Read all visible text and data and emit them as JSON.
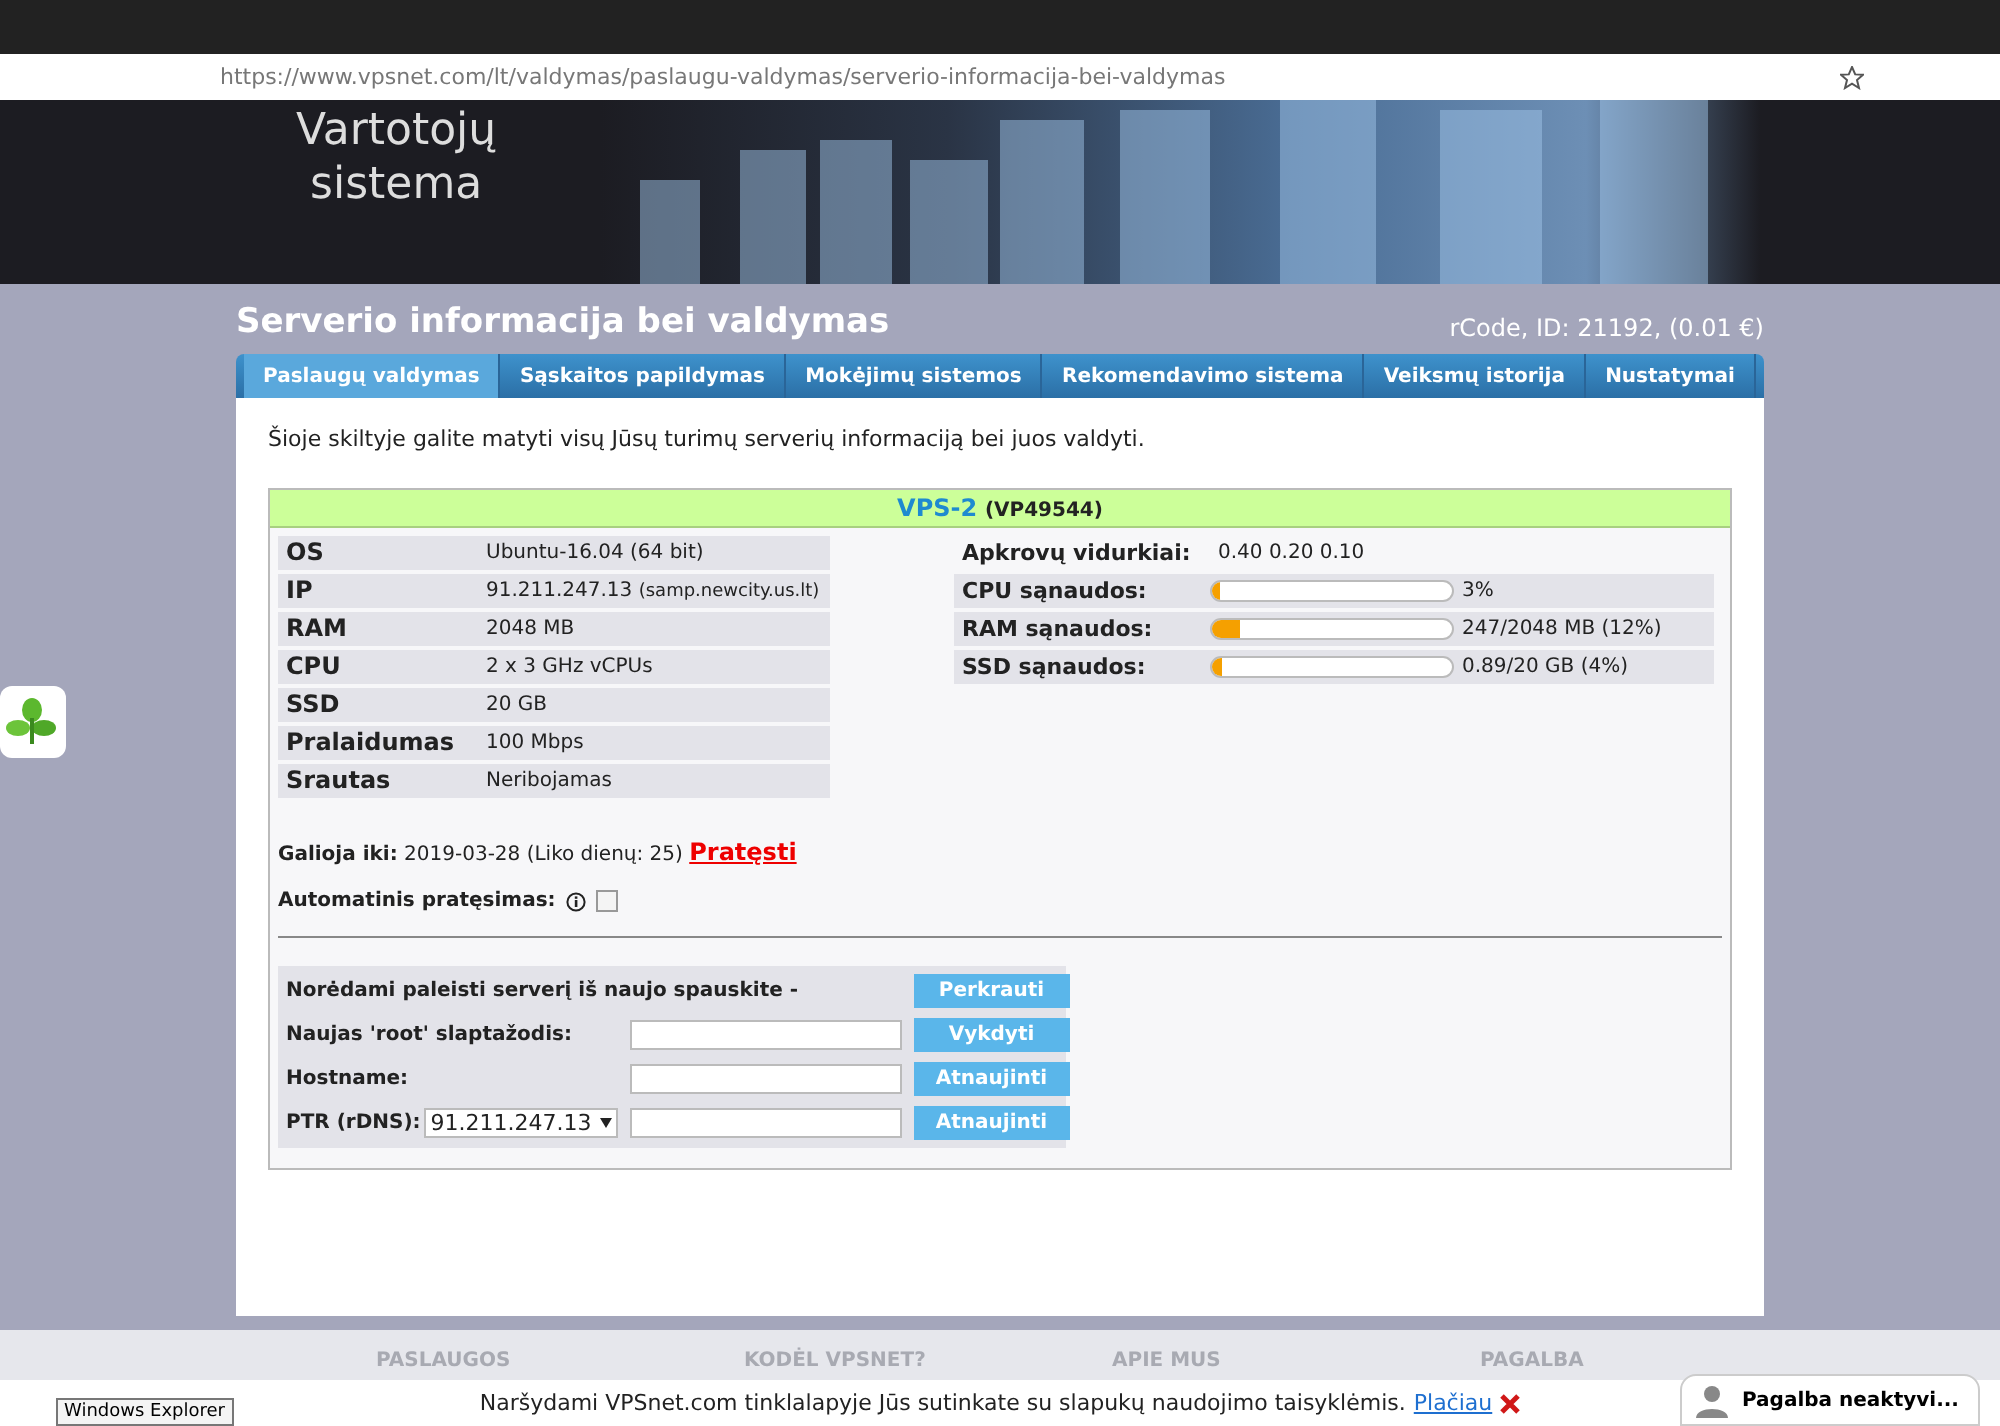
{
  "browser": {
    "url": "https://www.vpsnet.com/lt/valdymas/paslaugu-valdymas/serverio-informacija-bei-valdymas"
  },
  "banner": {
    "title_lines": [
      "Vartotojų",
      "sistema"
    ],
    "kind": "picture"
  },
  "page": {
    "title": "Serverio informacija bei valdymas",
    "account": "rCode, ID: 21192, (0.01 €)"
  },
  "tabs": [
    {
      "label": "Paslaugų valdymas",
      "selected": true
    },
    {
      "label": "Sąskaitos papildymas",
      "selected": false
    },
    {
      "label": "Mokėjimų sistemos",
      "selected": false
    },
    {
      "label": "Rekomendavimo sistema",
      "selected": false
    },
    {
      "label": "Veiksmų istorija",
      "selected": false
    },
    {
      "label": "Nustatymai",
      "selected": false
    }
  ],
  "intro": "Šioje skiltyje galite matyti visų Jūsų turimų serverių informaciją bei juos valdyti.",
  "vps": {
    "name": "VPS-2",
    "code": "(VP49544)",
    "specs": [
      {
        "label": "OS",
        "value": "Ubuntu-16.04 (64 bit)"
      },
      {
        "label": "IP",
        "value": "91.211.247.13",
        "note": "(samp.newcity.us.lt)"
      },
      {
        "label": "RAM",
        "value": "2048 MB"
      },
      {
        "label": "CPU",
        "value": "2 x 3 GHz vCPUs"
      },
      {
        "label": "SSD",
        "value": "20 GB"
      },
      {
        "label": "Pralaidumas",
        "value": "100 Mbps"
      },
      {
        "label": "Srautas",
        "value": "Neribojamas"
      }
    ],
    "load": {
      "label": "Apkrovų vidurkiai:",
      "value": "0.40 0.20 0.10"
    },
    "meters": [
      {
        "label": "CPU sąnaudos:",
        "level": 0.03,
        "reading": "3%"
      },
      {
        "label": "RAM sąnaudos:",
        "level": 0.12,
        "reading": "247/2048 MB (12%)"
      },
      {
        "label": "SSD sąnaudos:",
        "level": 0.04,
        "reading": "0.89/20 GB (4%)"
      }
    ],
    "expiry": {
      "label": "Galioja iki:",
      "date": "2019-03-28",
      "remaining": "(Liko dienų: 25)",
      "link": "Pratęsti"
    },
    "auto_renew": {
      "label": "Automatinis pratęsimas:",
      "checked": false
    }
  },
  "actions": [
    {
      "kind": "plain",
      "label": "Norėdami paleisti serverį iš naujo spauskite -",
      "button": "Perkrauti"
    },
    {
      "kind": "input",
      "label": "Naujas 'root' slaptažodis:",
      "button": "Vykdyti"
    },
    {
      "kind": "input",
      "label": "Hostname:",
      "button": "Atnaujinti"
    },
    {
      "kind": "select",
      "label": "PTR (rDNS):",
      "select": "91.211.247.13",
      "button": "Atnaujinti"
    }
  ],
  "footer": {
    "headings": [
      "PASLAUGOS",
      "KODĖL VPSNET?",
      "APIE MUS",
      "PAGALBA"
    ],
    "cookie": {
      "text": "Naršydami VPSnet.com tinklalapyje Jūs sutinkate su slapukų naudojimo taisyklėmis.",
      "link": "Plačiau"
    },
    "tooltip": "Windows Explorer",
    "chat": "Pagalba neaktyvi..."
  }
}
